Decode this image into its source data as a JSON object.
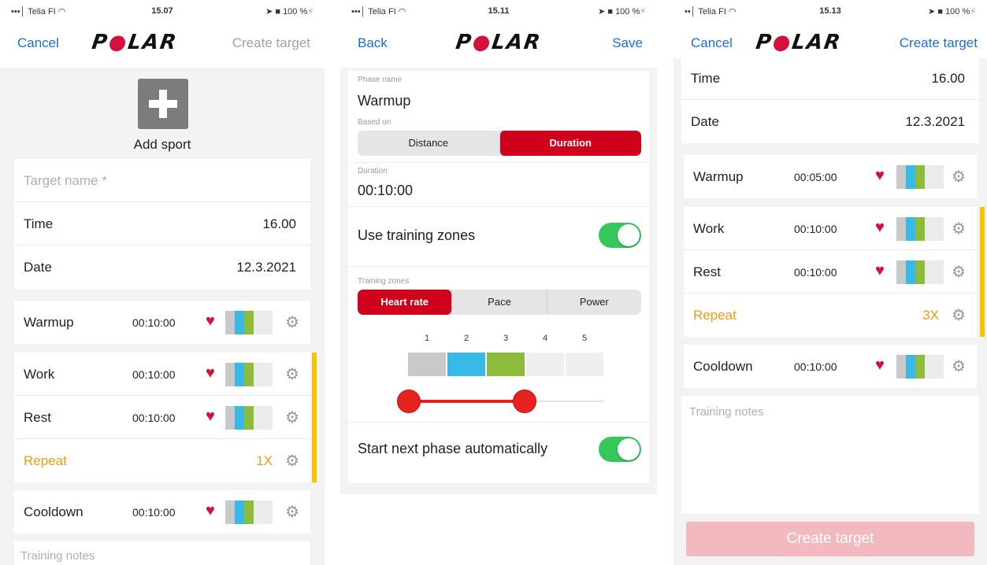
{
  "screens": {
    "s1": {
      "status": {
        "carrier": "•••│ Telia FI ◠",
        "time": "15.07",
        "battery": "➤ ■ 100 %",
        "charge": "⚡"
      },
      "nav": {
        "left": "Cancel",
        "logo_a": "P",
        "logo_o": "●",
        "logo_b": "LAR",
        "right": "Create target"
      },
      "add_sport_label": "Add sport",
      "target_name_placeholder": "Target name *",
      "time_label": "Time",
      "time_value": "16.00",
      "date_label": "Date",
      "date_value": "12.3.2021",
      "phases": {
        "warmup": {
          "name": "Warmup",
          "duration": "00:10:00"
        },
        "work": {
          "name": "Work",
          "duration": "00:10:00"
        },
        "rest": {
          "name": "Rest",
          "duration": "00:10:00"
        },
        "repeat": {
          "label": "Repeat",
          "count": "1X"
        },
        "cooldown": {
          "name": "Cooldown",
          "duration": "00:10:00"
        }
      },
      "notes_placeholder": "Training notes"
    },
    "s2": {
      "status": {
        "carrier": "•••│ Telia FI ◠",
        "time": "15.11",
        "battery": "➤ ■ 100 %",
        "charge": "⚡"
      },
      "nav": {
        "left": "Back",
        "logo_a": "P",
        "logo_o": "●",
        "logo_b": "LAR",
        "right": "Save"
      },
      "phase_name_label": "Phase name",
      "phase_name_value": "Warmup",
      "based_on_label": "Based on",
      "based_on_options": [
        "Distance",
        "Duration"
      ],
      "based_on_selected": "Duration",
      "duration_label": "Duration",
      "duration_value": "00:10:00",
      "use_zones_label": "Use training zones",
      "use_zones_on": true,
      "training_zones_label": "Training zones",
      "zone_type_options": [
        "Heart rate",
        "Pace",
        "Power"
      ],
      "zone_type_selected": "Heart rate",
      "zone_numbers": [
        "1",
        "2",
        "3",
        "4",
        "5"
      ],
      "zone_range": {
        "from": 2,
        "to": 3
      },
      "auto_next_label": "Start next phase automatically",
      "auto_next_on": true
    },
    "s3": {
      "status": {
        "carrier": "••│ Telia FI ◠",
        "time": "15.13",
        "battery": "➤ ■ 100 %",
        "charge": "⚡"
      },
      "nav": {
        "left": "Cancel",
        "logo_a": "P",
        "logo_o": "●",
        "logo_b": "LAR",
        "right": "Create target"
      },
      "time_label": "Time",
      "time_value": "16.00",
      "date_label": "Date",
      "date_value": "12.3.2021",
      "phases": {
        "warmup": {
          "name": "Warmup",
          "duration": "00:05:00"
        },
        "work": {
          "name": "Work",
          "duration": "00:10:00"
        },
        "rest": {
          "name": "Rest",
          "duration": "00:10:00"
        },
        "repeat": {
          "label": "Repeat",
          "count": "3X"
        },
        "cooldown": {
          "name": "Cooldown",
          "duration": "00:10:00"
        }
      },
      "notes_placeholder": "Training notes",
      "create_button": "Create target"
    }
  },
  "icons": {
    "heart": "♥",
    "gear": "⚙",
    "plus": "plus-icon"
  },
  "colors": {
    "accent_blue": "#1a6fd6",
    "polar_red": "#d0021b",
    "repeat_orange": "#f39c12",
    "toggle_green": "#34c759",
    "repeat_bracket": "#f7c400"
  }
}
